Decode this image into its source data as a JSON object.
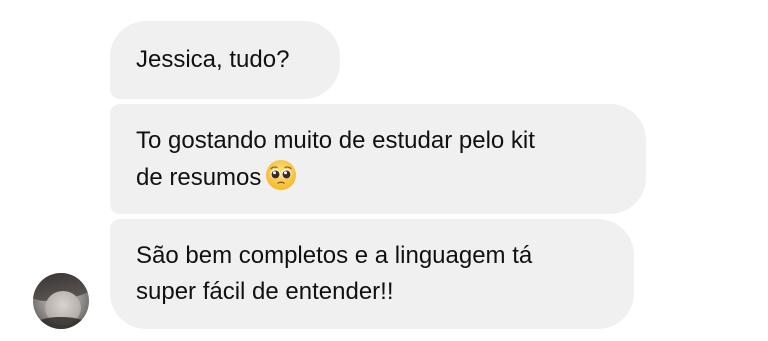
{
  "messages": [
    {
      "text": "Jessica, tudo?"
    },
    {
      "text": "To gostando muito de estudar pelo kit\nde resumos",
      "emoji": "pleading-face-emoji"
    },
    {
      "text": "São bem completos e a linguagem tá\nsuper fácil de entender!!"
    }
  ],
  "colors": {
    "bubble": "#f0f0f0",
    "text": "#111111",
    "background": "#ffffff"
  }
}
